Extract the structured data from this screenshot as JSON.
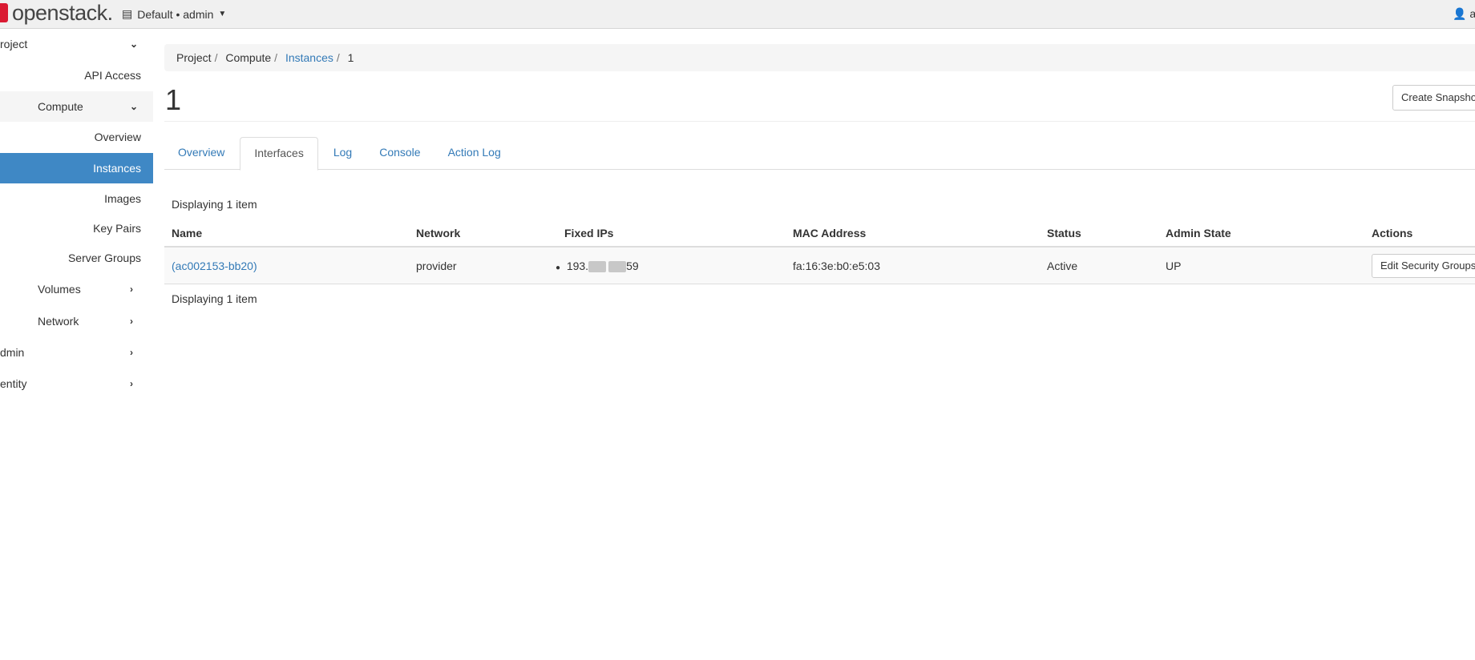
{
  "nav": {
    "brand": "openstack.",
    "project_selector": "Default • admin",
    "user": "ac"
  },
  "sidebar": {
    "project": "roject",
    "api_access": "API Access",
    "compute": "Compute",
    "items": [
      "Overview",
      "Instances",
      "Images",
      "Key Pairs",
      "Server Groups"
    ],
    "volumes": "Volumes",
    "network": "Network",
    "admin": "dmin",
    "identity": "entity"
  },
  "breadcrumb": [
    "Project",
    "Compute",
    "Instances",
    "1"
  ],
  "page": {
    "title": "1",
    "create_snapshot": "Create Snapshot"
  },
  "tabs": [
    "Overview",
    "Interfaces",
    "Log",
    "Console",
    "Action Log"
  ],
  "table": {
    "caption": "Displaying 1 item",
    "footer": "Displaying 1 item",
    "columns": [
      "Name",
      "Network",
      "Fixed IPs",
      "MAC Address",
      "Status",
      "Admin State",
      "Actions"
    ],
    "rows": [
      {
        "name": "(ac002153-bb20)",
        "network": "provider",
        "ip_prefix": "193.",
        "ip_suffix": "59",
        "mac": "fa:16:3e:b0:e5:03",
        "status": "Active",
        "admin_state": "UP",
        "action": "Edit Security Groups"
      }
    ]
  }
}
